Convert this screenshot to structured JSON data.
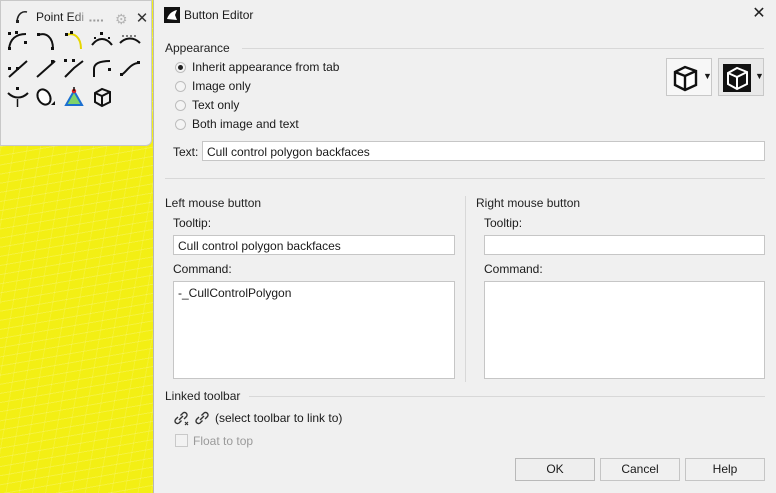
{
  "toolbar": {
    "title": "Point Edi",
    "grip": "▪▪▪▪",
    "close_glyph": "✕",
    "gear_glyph": "⚙"
  },
  "dialog": {
    "title": "Button Editor",
    "close_glyph": "✕",
    "appearance": {
      "label": "Appearance",
      "options": [
        {
          "label": "Inherit appearance from tab",
          "checked": true
        },
        {
          "label": "Image only",
          "checked": false
        },
        {
          "label": "Text only",
          "checked": false
        },
        {
          "label": "Both image and text",
          "checked": false
        }
      ],
      "text_label": "Text:",
      "text_value": "Cull control polygon backfaces",
      "dropdown_arrow": "▼"
    },
    "left_mouse": {
      "label": "Left mouse button",
      "tooltip_label": "Tooltip:",
      "tooltip_value": "Cull control polygon backfaces",
      "command_label": "Command:",
      "command_value": "-_CullControlPolygon"
    },
    "right_mouse": {
      "label": "Right mouse button",
      "tooltip_label": "Tooltip:",
      "tooltip_value": "",
      "command_label": "Command:",
      "command_value": ""
    },
    "linked_toolbar": {
      "label": "Linked toolbar",
      "link_text": "(select toolbar to link to)",
      "float_label": "Float to top",
      "float_checked": false
    },
    "buttons": {
      "ok": "OK",
      "cancel": "Cancel",
      "help": "Help"
    }
  }
}
